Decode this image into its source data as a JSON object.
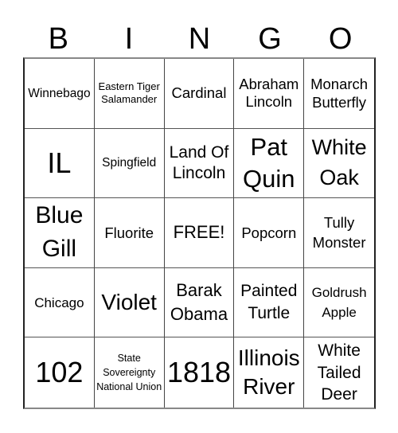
{
  "header": {
    "letters": [
      "B",
      "I",
      "N",
      "G",
      "O"
    ]
  },
  "cells": [
    [
      "Winnebago",
      "Eastern Tiger Salamander",
      "Cardinal",
      "Abraham Lincoln",
      "Monarch Butterfly"
    ],
    [
      "IL",
      "Spingfield",
      "Land Of Lincoln",
      "Pat Quin",
      "White Oak"
    ],
    [
      "Blue Gill",
      "Fluorite",
      "FREE!",
      "Popcorn",
      "Tully Monster"
    ],
    [
      "Chicago",
      "Violet",
      "Barak Obama",
      "Painted Turtle",
      "Goldrush Apple"
    ],
    [
      "102",
      "State Sovereignty National Union",
      "1818",
      "Illinois River",
      "White Tailed Deer"
    ]
  ]
}
